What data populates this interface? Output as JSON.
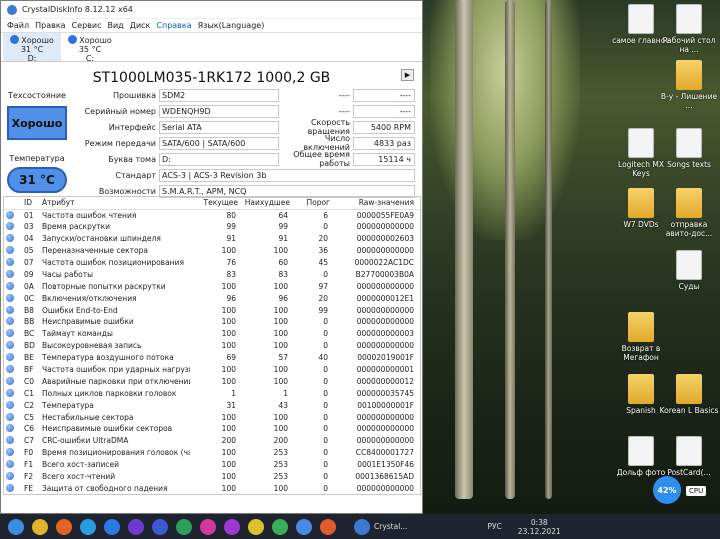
{
  "window": {
    "title": "CrystalDiskInfo 8.12.12 x64"
  },
  "menu": [
    "Файл",
    "Правка",
    "Сервис",
    "Вид",
    "Диск",
    "Справка",
    "Язык(Language)"
  ],
  "disks": [
    {
      "status": "Хорошо",
      "temp": "31 °C",
      "letter": "D:"
    },
    {
      "status": "Хорошо",
      "temp": "35 °C",
      "letter": "C:"
    }
  ],
  "drive": {
    "model": "ST1000LM035-1RK172 1000,2 GB",
    "health_label": "Техсостояние",
    "health_value": "Хорошо",
    "temp_label": "Температура",
    "temp_value": "31 °C",
    "firmware_label": "Прошивка",
    "firmware": "SDM2",
    "serial_label": "Серийный номер",
    "serial": "WDENQH9D",
    "interface_label": "Интерфейс",
    "interface": "Serial ATA",
    "transfer_label": "Режим передачи",
    "transfer": "SATA/600 | SATA/600",
    "volume_label": "Буква тома",
    "volume": "D:",
    "standard_label": "Стандарт",
    "standard": "ACS-3 | ACS-3 Revision 3b",
    "features_label": "Возможности",
    "features": "S.M.A.R.T., APM, NCQ",
    "r1_label": "----",
    "r1": "----",
    "r2_label": "----",
    "r2": "----",
    "rpm_label": "Скорость вращения",
    "rpm": "5400 RPM",
    "poweron_label": "Число включений",
    "poweron": "4833 раз",
    "hours_label": "Общее время работы",
    "hours": "15114 ч"
  },
  "table": {
    "headers": [
      "ID",
      "Атрибут",
      "Текущее",
      "Наихудшее",
      "Порог",
      "Raw-значения"
    ],
    "rows": [
      [
        "01",
        "Частота ошибок чтения",
        "80",
        "64",
        "6",
        "0000055FE0A9"
      ],
      [
        "03",
        "Время раскрутки",
        "99",
        "99",
        "0",
        "000000000000"
      ],
      [
        "04",
        "Запуски/остановки шпинделя",
        "91",
        "91",
        "20",
        "000000002603"
      ],
      [
        "05",
        "Переназначенные сектора",
        "100",
        "100",
        "36",
        "000000000000"
      ],
      [
        "07",
        "Частота ошибок позиционирования",
        "76",
        "60",
        "45",
        "0000022AC1DC"
      ],
      [
        "09",
        "Часы работы",
        "83",
        "83",
        "0",
        "B27700003B0A"
      ],
      [
        "0A",
        "Повторные попытки раскрутки",
        "100",
        "100",
        "97",
        "000000000000"
      ],
      [
        "0C",
        "Включения/отключения",
        "96",
        "96",
        "20",
        "0000000012E1"
      ],
      [
        "B8",
        "Ошибки End-to-End",
        "100",
        "100",
        "99",
        "000000000000"
      ],
      [
        "BB",
        "Неисправимые ошибки",
        "100",
        "100",
        "0",
        "000000000000"
      ],
      [
        "BC",
        "Таймаут команды",
        "100",
        "100",
        "0",
        "000000000003"
      ],
      [
        "BD",
        "Высокоуровневая запись",
        "100",
        "100",
        "0",
        "000000000000"
      ],
      [
        "BE",
        "Температура воздушного потока",
        "69",
        "57",
        "40",
        "00002019001F"
      ],
      [
        "BF",
        "Частота ошибок при ударных нагрузках",
        "100",
        "100",
        "0",
        "000000000001"
      ],
      [
        "C0",
        "Аварийные парковки при отключении пит...",
        "100",
        "100",
        "0",
        "000000000012"
      ],
      [
        "C1",
        "Полных циклов парковки головок",
        "1",
        "1",
        "0",
        "000000035745"
      ],
      [
        "C2",
        "Температура",
        "31",
        "43",
        "0",
        "00100000001F"
      ],
      [
        "C5",
        "Нестабильные сектора",
        "100",
        "100",
        "0",
        "000000000000"
      ],
      [
        "C6",
        "Неисправимые ошибки секторов",
        "100",
        "100",
        "0",
        "000000000000"
      ],
      [
        "C7",
        "CRC-ошибки UltraDMA",
        "200",
        "200",
        "0",
        "000000000000"
      ],
      [
        "F0",
        "Время позиционирования головок (часы)",
        "100",
        "253",
        "0",
        "CC8400001727"
      ],
      [
        "F1",
        "Всего хост-записей",
        "100",
        "253",
        "0",
        "0001E1350F46"
      ],
      [
        "F2",
        "Всего хост-чтений",
        "100",
        "253",
        "0",
        "0001368615AD"
      ],
      [
        "FE",
        "Защита от свободного падения",
        "100",
        "100",
        "0",
        "000000000000"
      ]
    ]
  },
  "desktop_icons": [
    {
      "label": "самое главное"
    },
    {
      "label": "Рабочий стол на ..."
    },
    {
      "label": "В-у - Лишение ..."
    },
    {
      "label": "Logitech MX Keys"
    },
    {
      "label": "Songs texts"
    },
    {
      "label": "W7 DVDs"
    },
    {
      "label": "отправка авито-дос..."
    },
    {
      "label": "Суды"
    },
    {
      "label": "Возврат в Мегафон"
    },
    {
      "label": "Spanish"
    },
    {
      "label": "Korean L Basics"
    },
    {
      "label": "Дольф фото"
    },
    {
      "label": "PostCard(..."
    }
  ],
  "widget": {
    "cpu_percent": "42%",
    "cpu_label": "CPU"
  },
  "taskbar": {
    "crystal_label": "Crystal...",
    "lang": "РУС",
    "time": "0:38",
    "date": "23.12.2021"
  }
}
